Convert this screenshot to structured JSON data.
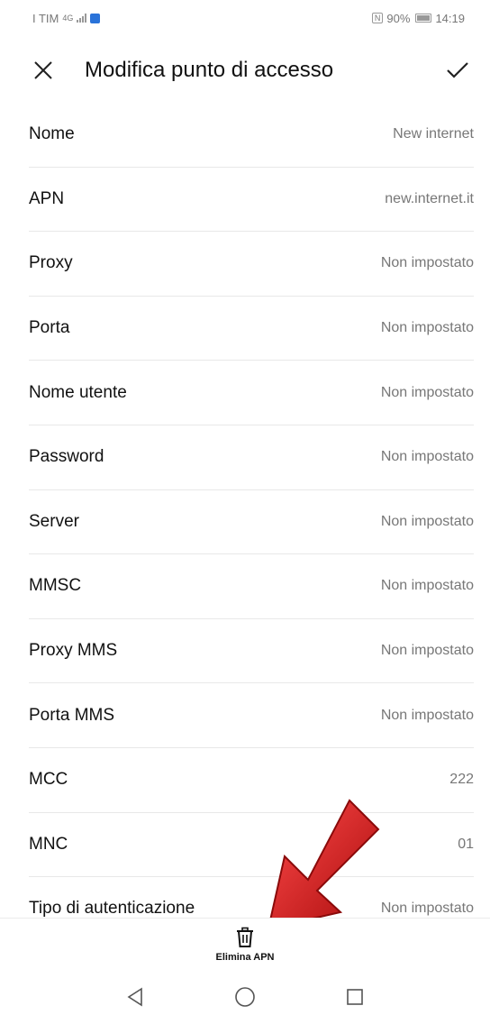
{
  "status_bar": {
    "carrier": "I TIM",
    "network": "4G",
    "nfc": "N",
    "battery": "90%",
    "time": "14:19"
  },
  "header": {
    "close_icon": "close-icon",
    "title": "Modifica punto di accesso",
    "confirm_icon": "check-icon"
  },
  "fields": [
    {
      "label": "Nome",
      "value": "New internet"
    },
    {
      "label": "APN",
      "value": "new.internet.it"
    },
    {
      "label": "Proxy",
      "value": "Non impostato"
    },
    {
      "label": "Porta",
      "value": "Non impostato"
    },
    {
      "label": "Nome utente",
      "value": "Non impostato"
    },
    {
      "label": "Password",
      "value": "Non impostato"
    },
    {
      "label": "Server",
      "value": "Non impostato"
    },
    {
      "label": "MMSC",
      "value": "Non impostato"
    },
    {
      "label": "Proxy MMS",
      "value": "Non impostato"
    },
    {
      "label": "Porta MMS",
      "value": "Non impostato"
    },
    {
      "label": "MCC",
      "value": "222"
    },
    {
      "label": "MNC",
      "value": "01"
    },
    {
      "label": "Tipo di autenticazione",
      "value": "Non impostato"
    }
  ],
  "bottom_bar": {
    "delete_icon": "trash-icon",
    "delete_label": "Elimina APN"
  },
  "nav_bar": {
    "back_icon": "back-triangle-icon",
    "home_icon": "home-circle-icon",
    "recents_icon": "recents-square-icon"
  },
  "overlay": {
    "arrow_icon": "red-arrow-icon",
    "arrow_color": "#d01818"
  }
}
